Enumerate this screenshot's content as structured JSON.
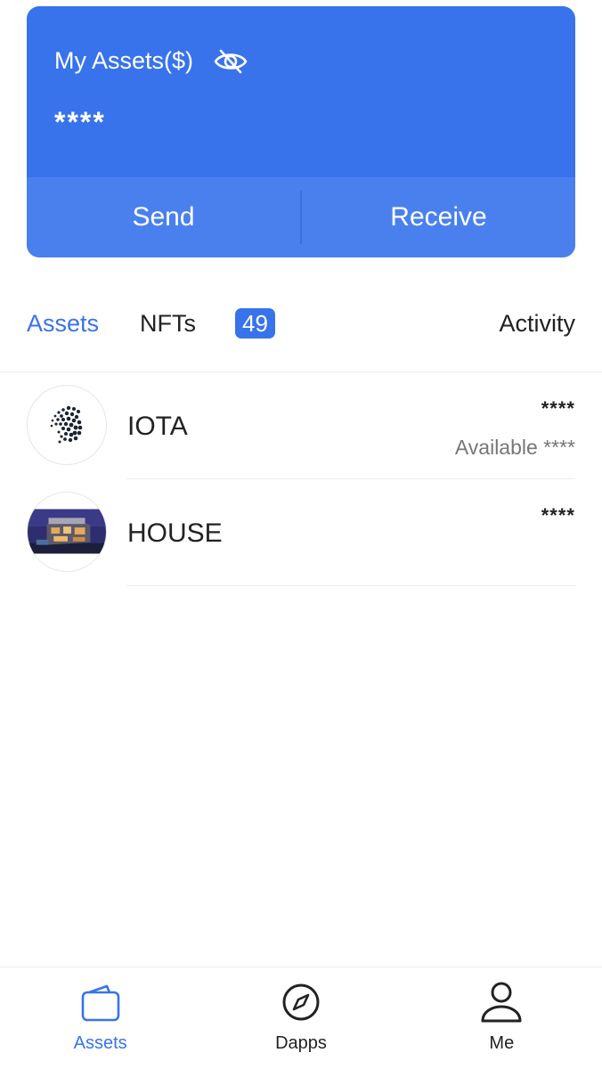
{
  "card": {
    "title": "My Assets($)",
    "balance": "****",
    "send_label": "Send",
    "receive_label": "Receive"
  },
  "tabs": {
    "assets": "Assets",
    "nfts": "NFTs",
    "nft_count": "49",
    "activity": "Activity"
  },
  "assets": [
    {
      "name": "IOTA",
      "amount": "****",
      "available": "Available ****",
      "icon": "iota-logo-icon"
    },
    {
      "name": "HOUSE",
      "amount": "****",
      "icon": "house-nft-icon"
    }
  ],
  "nav": [
    {
      "label": "Assets",
      "icon": "wallet-icon",
      "active": true
    },
    {
      "label": "Dapps",
      "icon": "compass-icon",
      "active": false
    },
    {
      "label": "Me",
      "icon": "user-icon",
      "active": false
    }
  ],
  "colors": {
    "accent": "#3873ec",
    "card_action_bg": "#4a80ee"
  }
}
